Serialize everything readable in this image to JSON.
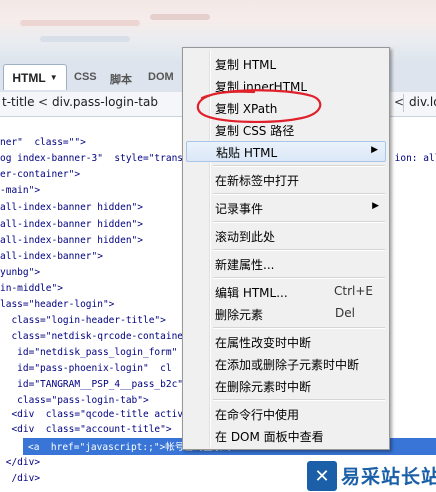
{
  "toolbar": {
    "tabs": [
      {
        "label": "HTML",
        "active": true
      },
      {
        "label": "CSS"
      },
      {
        "label": "脚本"
      },
      {
        "label": "DOM"
      }
    ]
  },
  "breadcrumb": {
    "items": [
      "t-title",
      "div.pass-login-tab",
      "div.lo"
    ]
  },
  "code_lines": [
    "ner\"  class=\"\">",
    "og index-banner-3\"  style=\"transfo                                   ion: all",
    "er-container\">",
    "-main\">",
    "all-index-banner hidden\">",
    "all-index-banner hidden\">",
    "all-index-banner hidden\">",
    "all-index-banner\">",
    "yunbg\">",
    "in-middle\">",
    "lass=\"header-login\">",
    "  class=\"login-header-title\">",
    "  class=\"netdisk-qrcode-container",
    "   id=\"netdisk_pass_login_form\"  c",
    "   id=\"pass-phoenix-login\"  cl",
    "   id=\"TANGRAM__PSP_4__pass_b2c\"",
    "   class=\"pass-login-tab\">",
    "  <div  class=\"qcode-title active\"",
    "  <div  class=\"account-title\">",
    "",
    " </div>",
    "  /div>"
  ],
  "selected_line": "<a  href=\"javascript:;\">帐号密码登录</a>",
  "context_menu": {
    "items": [
      {
        "label": "复制 HTML"
      },
      {
        "label": "复制 innerHTML"
      },
      {
        "label": "复制 XPath",
        "annotated": true
      },
      {
        "label": "复制 CSS 路径"
      },
      {
        "label": "粘贴 HTML",
        "submenu": true,
        "highlighted": true
      },
      {
        "label": "在新标签中打开"
      },
      {
        "label": "记录事件",
        "submenu": true
      },
      {
        "label": "滚动到此处"
      },
      {
        "label": "新建属性..."
      },
      {
        "label": "编辑 HTML...",
        "shortcut": "Ctrl+E"
      },
      {
        "label": "删除元素",
        "shortcut": "Del"
      },
      {
        "label": "在属性改变时中断"
      },
      {
        "label": "在添加或删除子元素时中断"
      },
      {
        "label": "在删除元素时中断"
      },
      {
        "label": "在命令行中使用"
      },
      {
        "label": "在 DOM 面板中查看"
      }
    ]
  },
  "watermark": {
    "mark": "✕",
    "text": "易采站长站"
  },
  "colors": {
    "selection": "#3875d7",
    "annotation": "#e0202a",
    "brand": "#1a5fa8"
  }
}
